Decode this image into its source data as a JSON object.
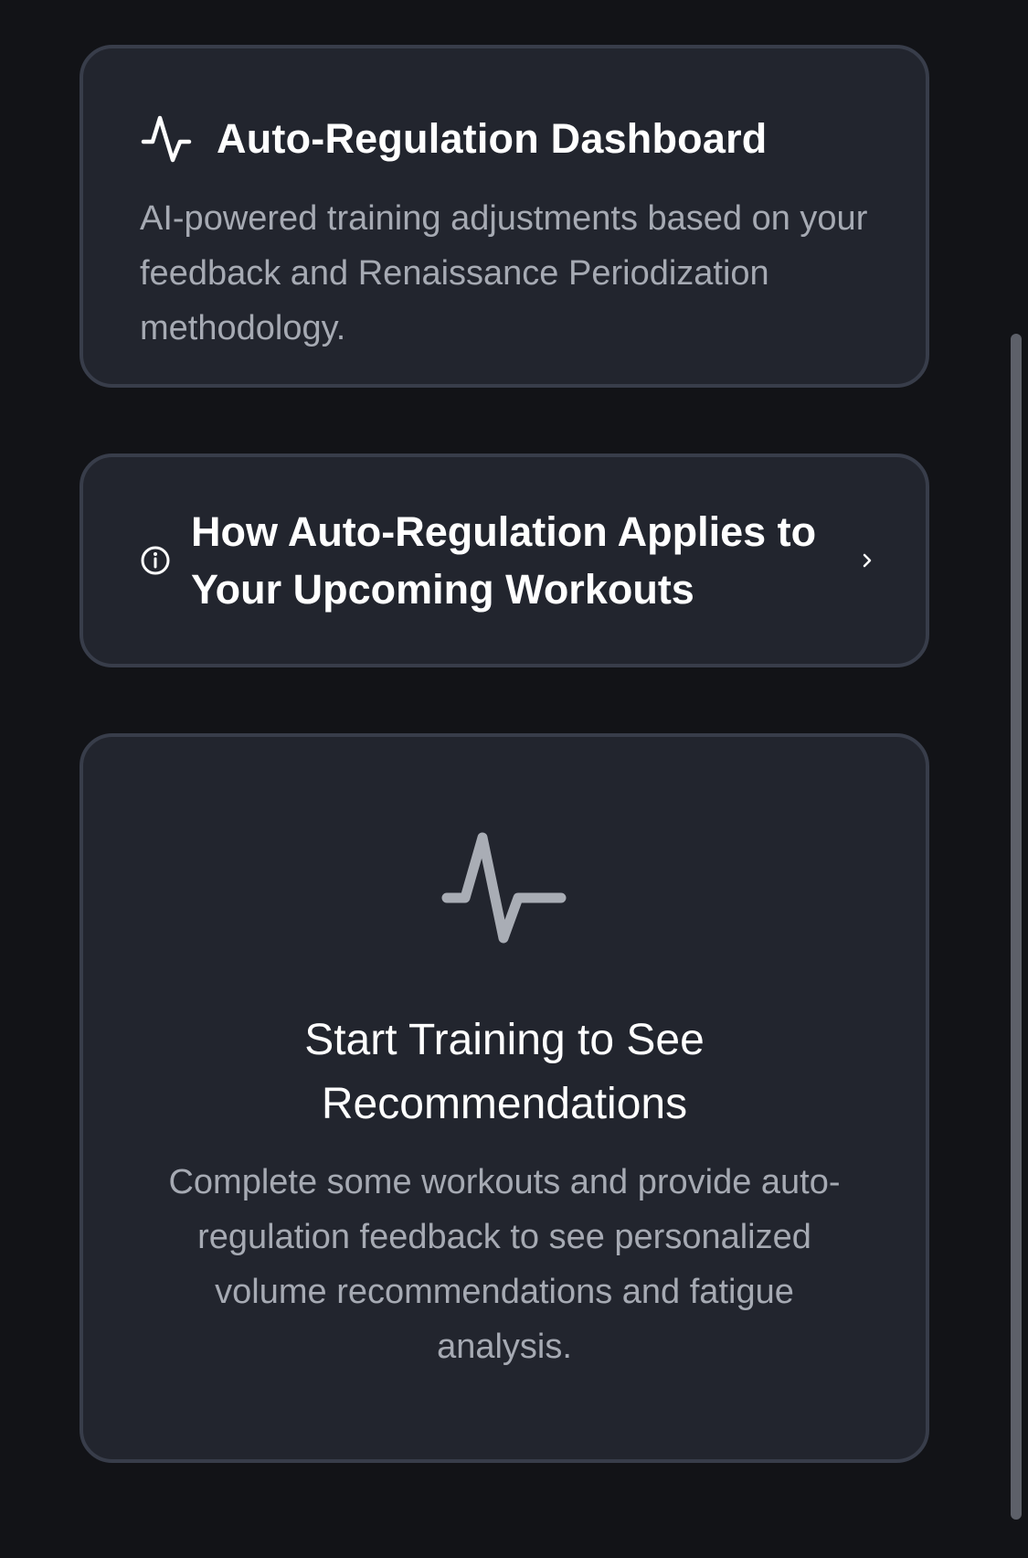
{
  "header_card": {
    "icon": "activity-icon",
    "title": "Auto-Regulation Dashboard",
    "description": "AI-powered training adjustments based on your feedback and Renaissance Periodization methodology."
  },
  "howto_card": {
    "icon": "info-icon",
    "title": "How Auto-Regulation Applies to Your Upcoming Workouts",
    "chevron": "chevron-right-icon"
  },
  "empty_state": {
    "icon": "activity-icon",
    "title": "Start Training to See Recommendations",
    "description": "Complete some workouts and provide auto-regulation feedback to see personalized volume recommendations and fatigue analysis."
  },
  "colors": {
    "background": "#121317",
    "card": "#22252e",
    "card_border": "#383d4a",
    "muted_text": "#a6aab3"
  }
}
